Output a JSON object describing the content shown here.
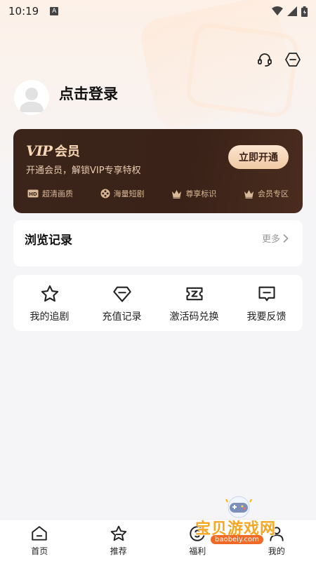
{
  "status_bar": {
    "time": "10:19",
    "notif_letter": "A"
  },
  "profile": {
    "login_text": "点击登录"
  },
  "vip": {
    "logo": "VIP",
    "label": "会员",
    "subtitle": "开通会员，解锁VIP专享特权",
    "button": "立即开通",
    "perks": [
      {
        "icon": "hd-icon",
        "label": "超清画质"
      },
      {
        "icon": "film-reel-icon",
        "label": "海量短剧"
      },
      {
        "icon": "crown-icon",
        "label": "尊享标识"
      },
      {
        "icon": "crown-icon",
        "label": "会员专区"
      }
    ],
    "colors": {
      "card": "#3b2419",
      "text": "#f7d7b5",
      "button": "#f1c9a4"
    }
  },
  "history": {
    "title": "浏览记录",
    "more": "更多"
  },
  "actions": [
    {
      "icon": "star-icon",
      "label": "我的追剧"
    },
    {
      "icon": "diamond-icon",
      "label": "充值记录"
    },
    {
      "icon": "ticket-icon",
      "label": "激活码兑换"
    },
    {
      "icon": "feedback-icon",
      "label": "我要反馈"
    }
  ],
  "bottom_nav": [
    {
      "icon": "home-icon",
      "label": "首页"
    },
    {
      "icon": "star-icon",
      "label": "推荐"
    },
    {
      "icon": "coin-icon",
      "label": "福利"
    },
    {
      "icon": "user-icon",
      "label": "我的"
    }
  ],
  "watermark": {
    "text": "宝贝游戏网",
    "url": "baobeiy.com"
  }
}
